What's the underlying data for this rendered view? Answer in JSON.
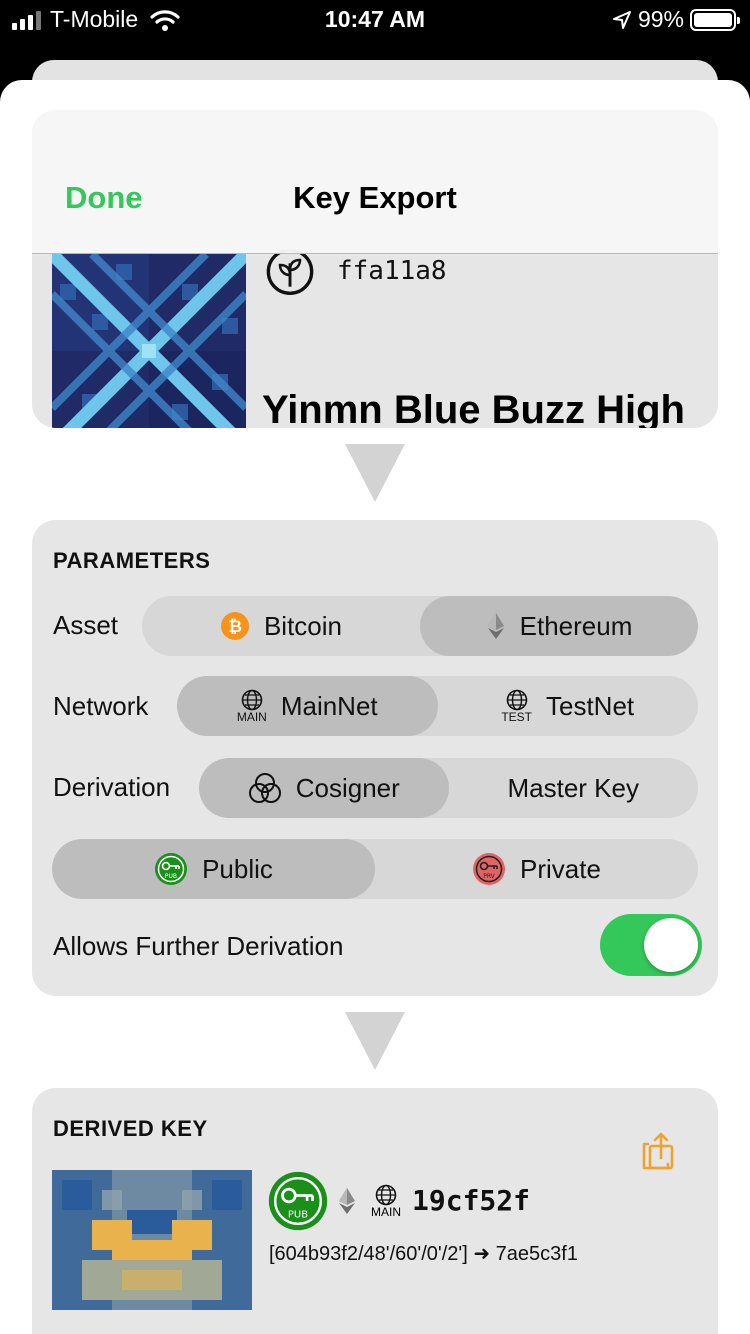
{
  "status_bar": {
    "carrier": "T-Mobile",
    "time": "10:47 AM",
    "battery": "99%"
  },
  "nav": {
    "done_label": "Done",
    "title": "Key Export"
  },
  "seed": {
    "id": "ffa11a8",
    "name": "Yinmn Blue Buzz High"
  },
  "parameters": {
    "title": "PARAMETERS",
    "asset": {
      "label": "Asset",
      "options": [
        "Bitcoin",
        "Ethereum"
      ],
      "selected": "Ethereum"
    },
    "network": {
      "label": "Network",
      "options": [
        "MainNet",
        "TestNet"
      ],
      "badges": [
        "MAIN",
        "TEST"
      ],
      "selected": "MainNet"
    },
    "derivation": {
      "label": "Derivation",
      "options": [
        "Cosigner",
        "Master Key"
      ],
      "selected": "Cosigner"
    },
    "key_type": {
      "options": [
        "Public",
        "Private"
      ],
      "badges": [
        "PUB",
        "PRV"
      ],
      "selected": "Public"
    },
    "further_derivation": {
      "label": "Allows Further Derivation",
      "enabled": true
    }
  },
  "derived_key": {
    "title": "DERIVED KEY",
    "type_badge": "PUB",
    "network_badge": "MAIN",
    "id": "19cf52f",
    "path": "[604b93f2/48'/60'/0'/2'] ➜ 7ae5c3f1"
  },
  "colors": {
    "accent_green": "#34c759",
    "bitcoin_orange": "#f7931a",
    "share_orange": "#f0a22e",
    "pub_green": "#1a8f1a",
    "prv_red": "#e06464"
  }
}
